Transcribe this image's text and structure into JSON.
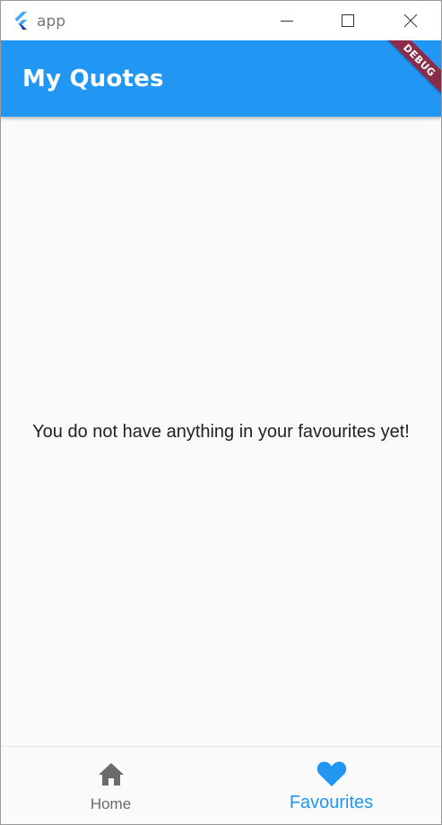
{
  "window": {
    "title": "app",
    "icons": {
      "app": "flutter-logo-icon",
      "minimize": "minimize-icon",
      "maximize": "maximize-icon",
      "close": "close-icon"
    }
  },
  "appbar": {
    "title": "My Quotes",
    "debug_banner": "DEBUG"
  },
  "main": {
    "empty_message": "You do not have anything in your favourites yet!"
  },
  "bottom_nav": {
    "items": [
      {
        "label": "Home",
        "icon": "home-icon",
        "selected": false
      },
      {
        "label": "Favourites",
        "icon": "heart-icon",
        "selected": true
      }
    ]
  },
  "colors": {
    "primary": "#2196f3",
    "debug_banner": "#8b2d4a",
    "background": "#fafafa",
    "inactive": "#6b6b6b",
    "text": "#222222"
  }
}
